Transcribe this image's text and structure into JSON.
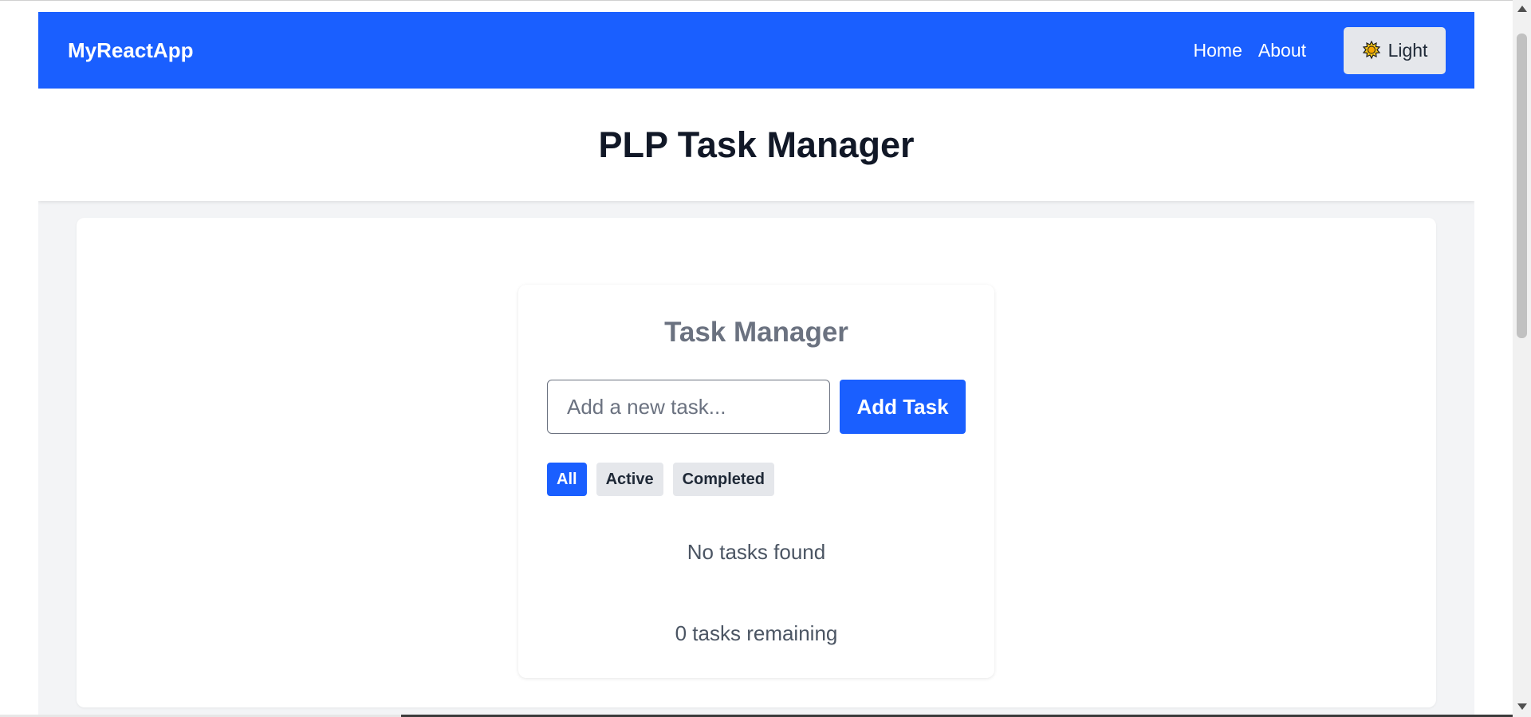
{
  "navbar": {
    "brand": "MyReactApp",
    "links": [
      "Home",
      "About"
    ],
    "theme_toggle": {
      "icon": "sun-icon",
      "label": "Light"
    }
  },
  "header": {
    "title": "PLP Task Manager"
  },
  "task_manager": {
    "title": "Task Manager",
    "input": {
      "placeholder": "Add a new task...",
      "value": ""
    },
    "add_button": "Add Task",
    "filters": [
      {
        "label": "All",
        "active": true
      },
      {
        "label": "Active",
        "active": false
      },
      {
        "label": "Completed",
        "active": false
      }
    ],
    "empty_message": "No tasks found",
    "remaining": "0 tasks remaining"
  },
  "colors": {
    "primary": "#1a5fff",
    "page_bg": "#f3f4f6",
    "muted_text": "#6b7280",
    "heading_text": "#111827"
  }
}
